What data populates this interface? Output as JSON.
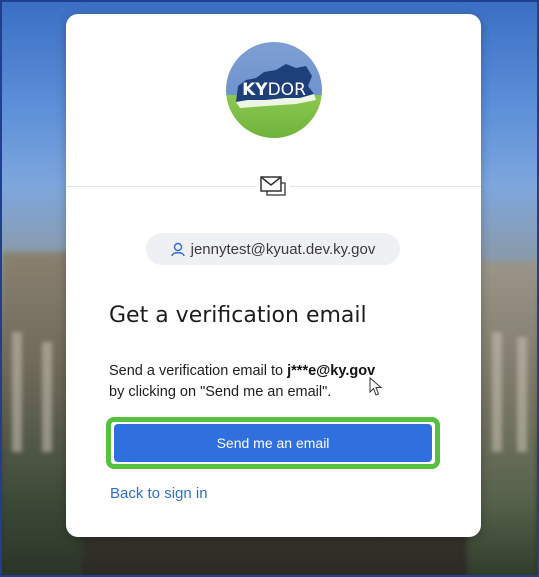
{
  "logo": {
    "text_ky": "KY",
    "text_dor": "DOR"
  },
  "icons": {
    "mail": "mail-icon",
    "user": "user-icon",
    "cursor": "pointer-cursor"
  },
  "user_pill": {
    "email": "jennytest@kyuat.dev.ky.gov"
  },
  "heading": "Get a verification email",
  "description": {
    "line1_prefix": "Send a verification email to ",
    "masked_email": "j***e@ky.gov",
    "line2": "by clicking on \"Send me an email\"."
  },
  "primary_button": {
    "label": "Send me an email"
  },
  "back_link": {
    "label": "Back to sign in"
  },
  "colors": {
    "primary": "#2f6fde",
    "highlight": "#58c040",
    "link": "#2f6fc7"
  }
}
